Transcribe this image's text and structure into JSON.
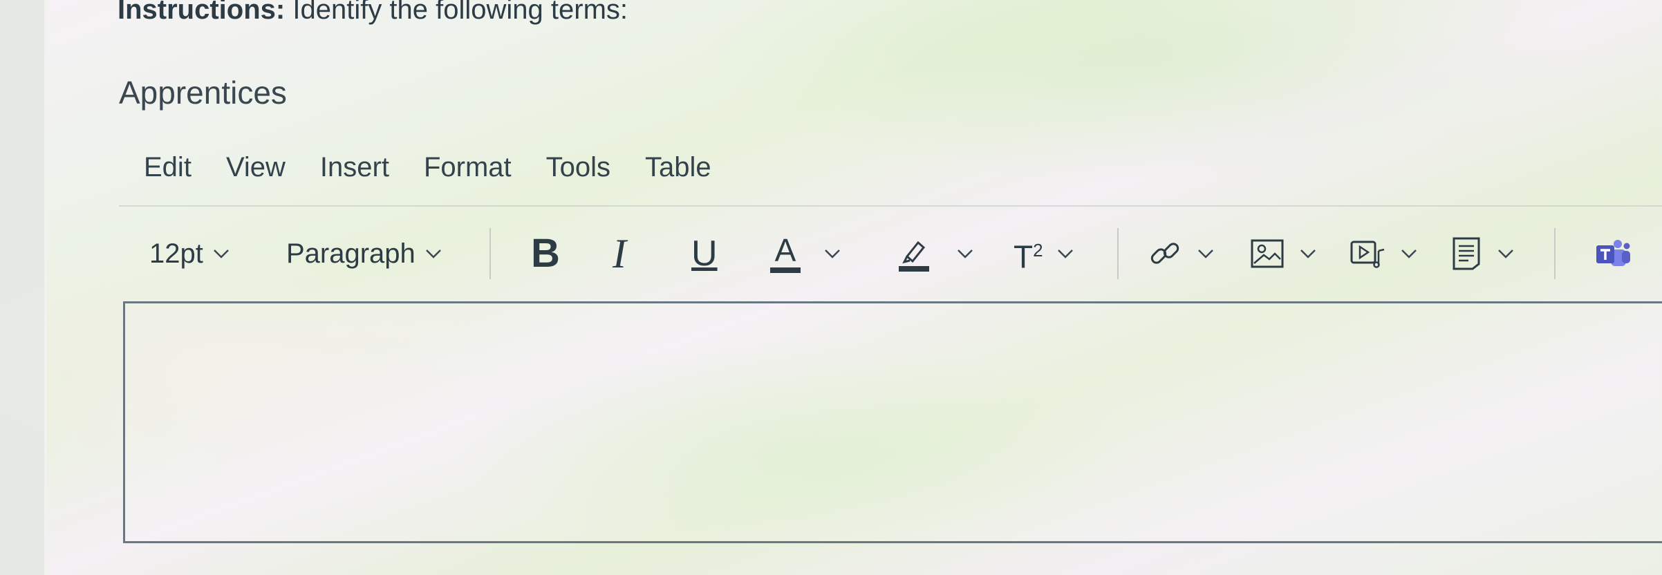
{
  "instructions": {
    "label": "Instructions:",
    "text": " Identify the following terms:"
  },
  "term": "Apprentices",
  "menubar": {
    "items": [
      "Edit",
      "View",
      "Insert",
      "Format",
      "Tools",
      "Table"
    ]
  },
  "toolbar": {
    "font_size": "12pt",
    "block_format": "Paragraph",
    "superscript_label": "T",
    "superscript_exp": "2",
    "bold_glyph": "B",
    "italic_glyph": "I",
    "underline_glyph": "U",
    "text_color_glyph": "A",
    "icons": {
      "font_size_dropdown": "chevron-down-icon",
      "bold": "bold-icon",
      "italic": "italic-icon",
      "underline": "underline-icon",
      "text_color": "text-color-icon",
      "highlight": "highlighter-icon",
      "superscript": "superscript-icon",
      "link": "link-icon",
      "image": "image-icon",
      "media": "media-icon",
      "document": "document-icon",
      "teams": "microsoft-teams-icon"
    }
  },
  "colors": {
    "text": "#2d3b45",
    "color_swatch": "#2d3b45",
    "editor_border": "#6a7680",
    "teams_brand": "#5b5fc7"
  }
}
